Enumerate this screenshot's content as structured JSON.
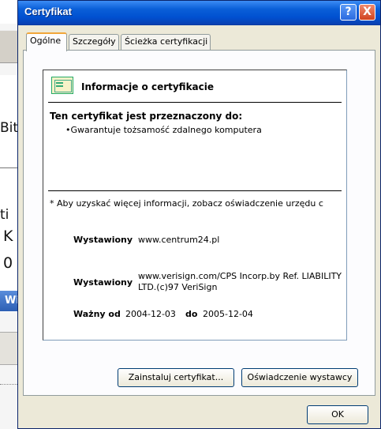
{
  "background_window": {
    "texts": [
      "Bit",
      "ti",
      "K",
      "0",
      "Wir"
    ]
  },
  "dialog": {
    "title": "Certyfikat",
    "help_button": "?",
    "close_button": "X",
    "tabs": [
      {
        "label": "Ogólne",
        "active": true
      },
      {
        "label": "Szczegóły",
        "active": false
      },
      {
        "label": "Ścieżka certyfikacji",
        "active": false
      }
    ],
    "info": {
      "icon": "certificate-icon",
      "heading": "Informacje o certyfikacie",
      "purpose_title": "Ten certyfikat jest przeznaczony do:",
      "purpose_items": [
        "•Gwarantuje tożsamość zdalnego komputera"
      ],
      "note": "* Aby uzyskać więcej informacji, zobacz oświadczenie urzędu c",
      "issued_to_label": "Wystawiony",
      "issued_to_value": "www.centrum24.pl",
      "issued_by_label": "Wystawiony",
      "issued_by_value_line1": "www.verisign.com/CPS Incorp.by Ref. LIABILITY",
      "issued_by_value_line2": "LTD.(c)97 VeriSign",
      "valid_from_label": "Ważny od",
      "valid_from_value": "2004-12-03",
      "valid_to_label": "do",
      "valid_to_value": "2005-12-04"
    },
    "buttons": {
      "install": "Zainstaluj certyfikat...",
      "issuer_statement": "Oświadczenie wystawcy",
      "ok": "OK"
    }
  }
}
